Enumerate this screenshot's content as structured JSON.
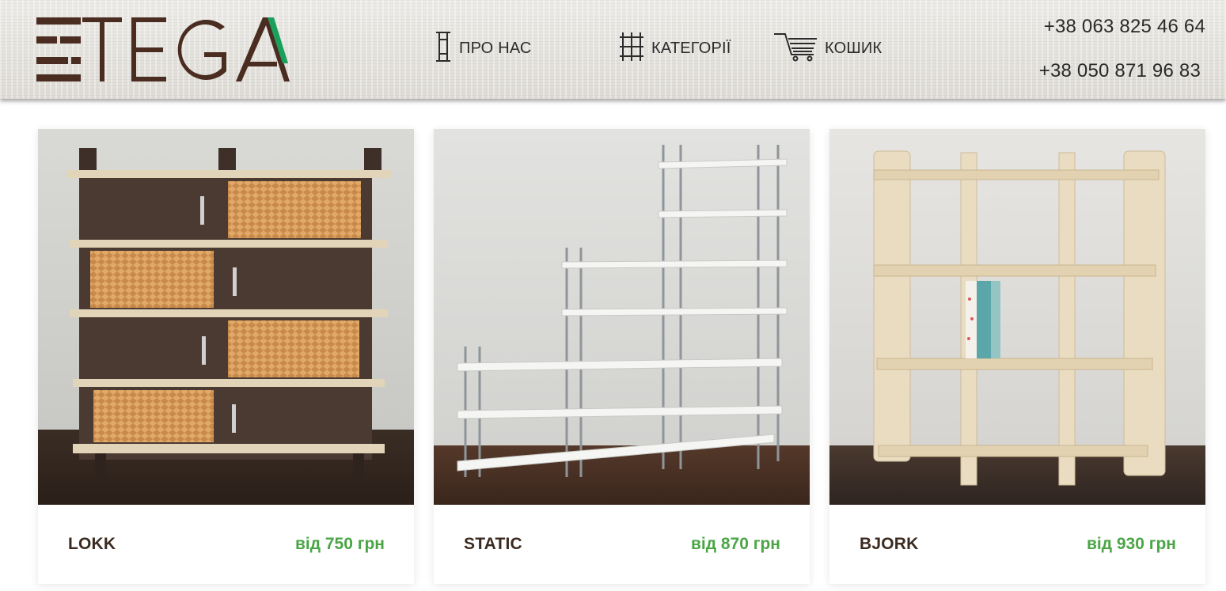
{
  "brand": {
    "logo_text": "TEGA",
    "accent_color": "#1aa05a",
    "brand_color": "#4a2c21"
  },
  "nav": {
    "about_label": "ПРО НАС",
    "categories_label": "КАТЕГОРІЇ",
    "cart_label": "КОШИК"
  },
  "contacts": {
    "phone_1": "+38 063 825 46 64",
    "phone_2": "+38 050 871 96 83"
  },
  "products": [
    {
      "name": "LOKK",
      "price": "від 750 грн"
    },
    {
      "name": "STATIC",
      "price": "від 870 грн"
    },
    {
      "name": "BJORK",
      "price": "від 930 грн"
    }
  ],
  "colors": {
    "price_green": "#4ba546",
    "title_brown": "#3b2a20"
  }
}
